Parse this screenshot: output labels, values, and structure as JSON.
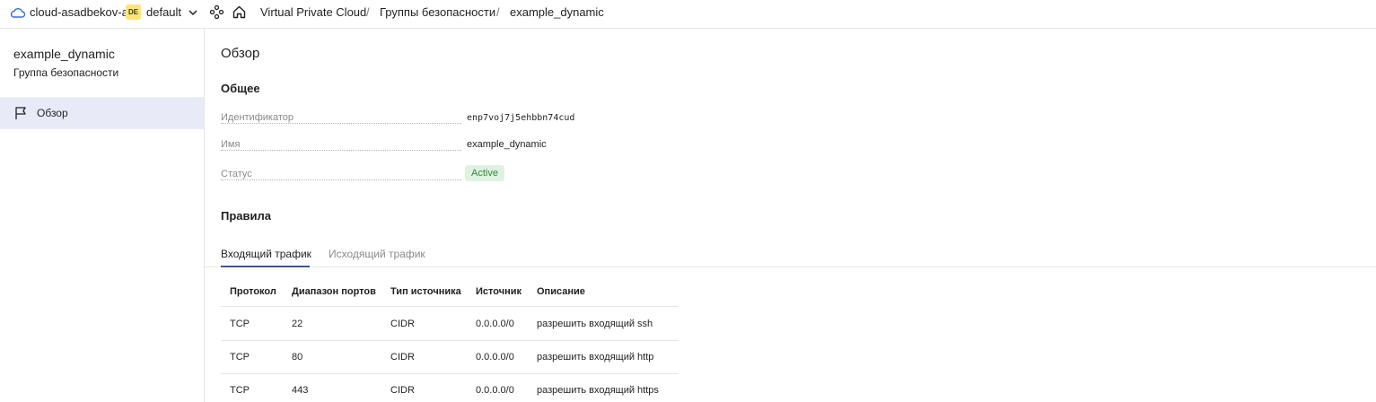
{
  "topbar": {
    "cloud_name": "cloud-asadbekov-a",
    "folder_badge": "DE",
    "folder_name": "default",
    "breadcrumbs": [
      "Virtual Private Cloud",
      "Группы безопасности",
      "example_dynamic"
    ],
    "separator": "/"
  },
  "sidebar": {
    "title": "example_dynamic",
    "subtitle": "Группа безопасности",
    "items": [
      {
        "label": "Обзор",
        "icon": "flag-icon"
      }
    ]
  },
  "main": {
    "page_title": "Обзор",
    "general": {
      "title": "Общее",
      "id_label": "Идентификатор",
      "id_value": "enp7voj7j5ehbbn74cud",
      "name_label": "Имя",
      "name_value": "example_dynamic",
      "status_label": "Статус",
      "status_value": "Active"
    },
    "rules": {
      "title": "Правила",
      "tabs": [
        "Входящий трафик",
        "Исходящий трафик"
      ],
      "active_tab": "Входящий трафик",
      "columns": [
        "Протокол",
        "Диапазон портов",
        "Тип источника",
        "Источник",
        "Описание"
      ],
      "rows": [
        [
          "TCP",
          "22",
          "CIDR",
          "0.0.0.0/0",
          "разрешить входящий ssh"
        ],
        [
          "TCP",
          "80",
          "CIDR",
          "0.0.0.0/0",
          "разрешить входящий http"
        ],
        [
          "TCP",
          "443",
          "CIDR",
          "0.0.0.0/0",
          "разрешить входящий https"
        ]
      ]
    }
  },
  "colors": {
    "sidebar_active_bg": "#e8ebf7",
    "status_bg": "#dff2e1",
    "status_text": "#2f8a3e",
    "badge_bg": "#fde37a",
    "tab_underline": "#3b5998"
  }
}
